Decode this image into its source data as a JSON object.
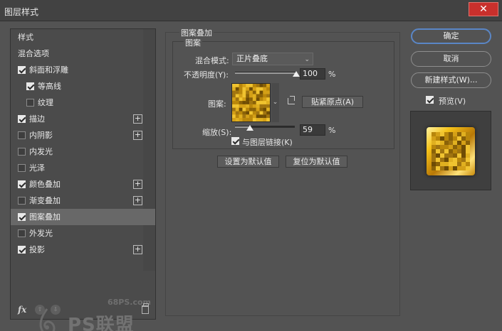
{
  "window": {
    "title": "图层样式",
    "close_glyph": "✕"
  },
  "sidebar": {
    "items": [
      {
        "label": "样式",
        "checkbox": false,
        "checked": false,
        "plus": false,
        "sub": false,
        "active": false
      },
      {
        "label": "混合选项",
        "checkbox": false,
        "checked": false,
        "plus": false,
        "sub": false,
        "active": false
      },
      {
        "label": "斜面和浮雕",
        "checkbox": true,
        "checked": true,
        "plus": false,
        "sub": false,
        "active": false
      },
      {
        "label": "等高线",
        "checkbox": true,
        "checked": true,
        "plus": false,
        "sub": true,
        "active": false
      },
      {
        "label": "纹理",
        "checkbox": true,
        "checked": false,
        "plus": false,
        "sub": true,
        "active": false
      },
      {
        "label": "描边",
        "checkbox": true,
        "checked": true,
        "plus": true,
        "sub": false,
        "active": false
      },
      {
        "label": "内阴影",
        "checkbox": true,
        "checked": false,
        "plus": true,
        "sub": false,
        "active": false
      },
      {
        "label": "内发光",
        "checkbox": true,
        "checked": false,
        "plus": false,
        "sub": false,
        "active": false
      },
      {
        "label": "光泽",
        "checkbox": true,
        "checked": false,
        "plus": false,
        "sub": false,
        "active": false
      },
      {
        "label": "颜色叠加",
        "checkbox": true,
        "checked": true,
        "plus": true,
        "sub": false,
        "active": false
      },
      {
        "label": "渐变叠加",
        "checkbox": true,
        "checked": false,
        "plus": true,
        "sub": false,
        "active": false
      },
      {
        "label": "图案叠加",
        "checkbox": true,
        "checked": true,
        "plus": false,
        "sub": false,
        "active": true
      },
      {
        "label": "外发光",
        "checkbox": true,
        "checked": false,
        "plus": false,
        "sub": false,
        "active": false
      },
      {
        "label": "投影",
        "checkbox": true,
        "checked": true,
        "plus": true,
        "sub": false,
        "active": false
      }
    ],
    "plus_glyph": "+",
    "fx_label": "fx",
    "arrow_up_glyph": "⇧",
    "arrow_down_glyph": "⇩"
  },
  "watermark": {
    "url": "68PS.com",
    "brand": "PS联盟"
  },
  "pattern_overlay": {
    "group_title": "图案叠加",
    "section_title": "图案",
    "blend_mode_label": "混合模式:",
    "blend_mode_value": "正片叠底",
    "opacity_label": "不透明度(Y):",
    "opacity_value": "100",
    "opacity_percent": 100,
    "pattern_label": "图案:",
    "snap_origin_button": "贴紧原点(A)",
    "scale_label": "缩放(S):",
    "scale_value": "59",
    "scale_fraction": 0.59,
    "percent_unit": "%",
    "link_layer_label": "与图层链接(K)",
    "link_layer_checked": true,
    "set_default_button": "设置为默认值",
    "reset_default_button": "复位为默认值",
    "chevron_glyph": "⌄"
  },
  "actions": {
    "ok": "确定",
    "cancel": "取消",
    "new_style": "新建样式(W)...",
    "preview_label": "预览(V)",
    "preview_checked": true
  },
  "colors": {
    "accent": "#5a86c6",
    "close": "#c9302c",
    "gold": "#d9a40f"
  }
}
